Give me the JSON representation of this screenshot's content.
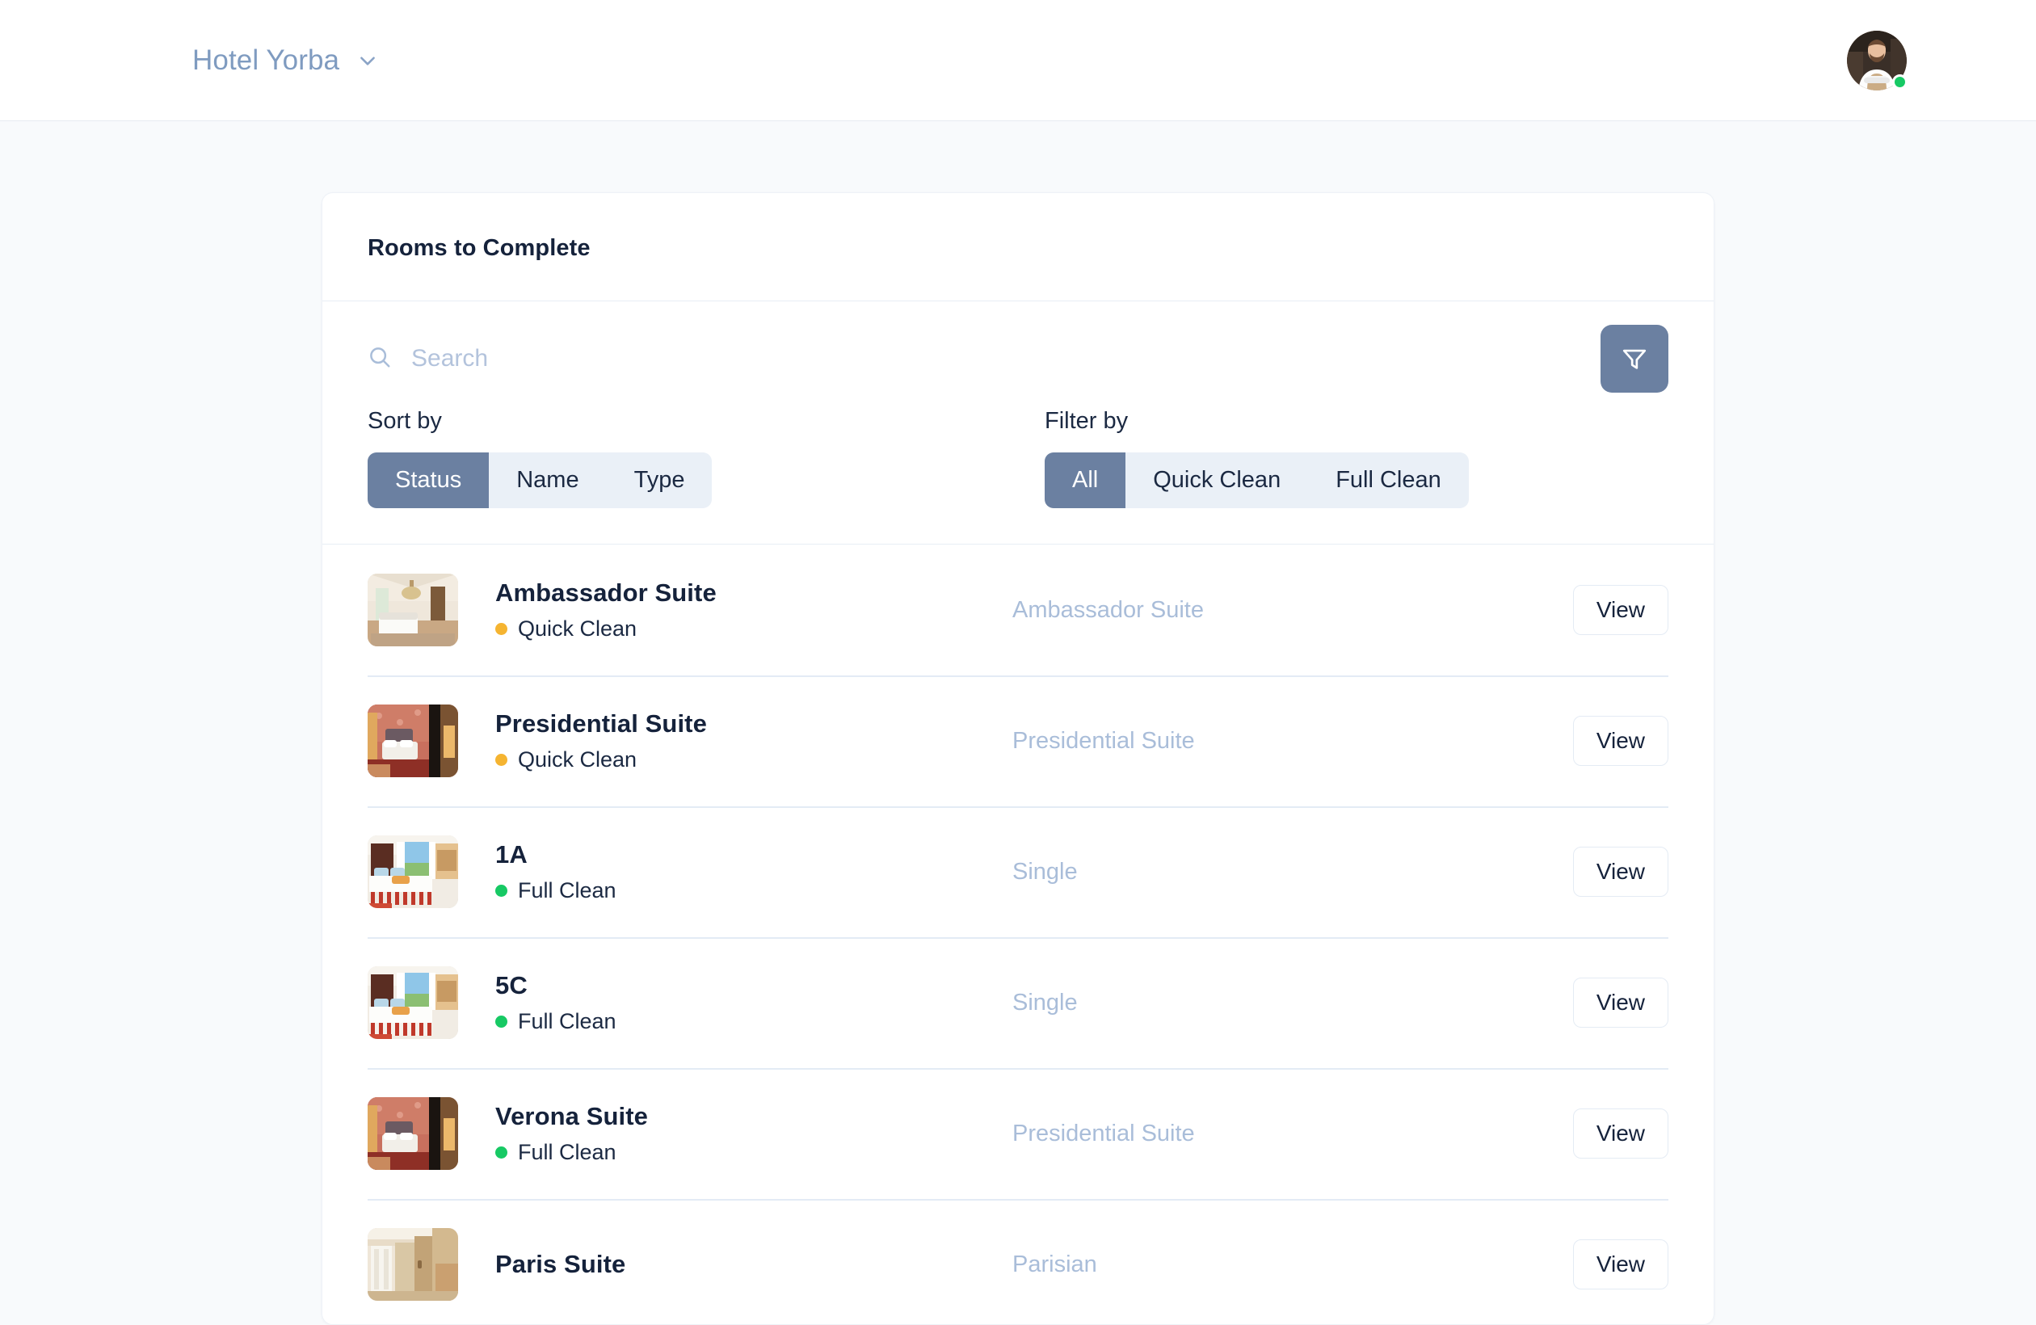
{
  "navbar": {
    "brand_label": "Hotel Yorba",
    "brand_caret_icon": "chevron-down-icon",
    "avatar_icon": "user-avatar-photo",
    "status": "online",
    "status_color": "#17c964"
  },
  "card": {
    "title": "Rooms to Complete"
  },
  "search": {
    "icon": "search-icon",
    "placeholder": "Search",
    "value": ""
  },
  "filter_button": {
    "icon": "funnel-icon",
    "color": "#6b80a1"
  },
  "sort": {
    "label": "Sort by",
    "options": [
      "Status",
      "Name",
      "Type"
    ],
    "selected": "Status"
  },
  "filter": {
    "label": "Filter by",
    "options": [
      "All",
      "Quick Clean",
      "Full Clean"
    ],
    "selected": "All"
  },
  "status_colors": {
    "quick_clean": "#f5b431",
    "full_clean": "#17c964"
  },
  "rows": [
    {
      "name": "Ambassador Suite",
      "status": "Quick Clean",
      "status_color": "#f5b431",
      "type": "Ambassador Suite",
      "action": "View",
      "thumb": "room-photo-ambassador"
    },
    {
      "name": "Presidential Suite",
      "status": "Quick Clean",
      "status_color": "#f5b431",
      "type": "Presidential Suite",
      "action": "View",
      "thumb": "room-photo-presidential"
    },
    {
      "name": "1A",
      "status": "Full Clean",
      "status_color": "#17c964",
      "type": "Single",
      "action": "View",
      "thumb": "room-photo-single"
    },
    {
      "name": "5C",
      "status": "Full Clean",
      "status_color": "#17c964",
      "type": "Single",
      "action": "View",
      "thumb": "room-photo-single"
    },
    {
      "name": "Verona Suite",
      "status": "Full Clean",
      "status_color": "#17c964",
      "type": "Presidential Suite",
      "action": "View",
      "thumb": "room-photo-verona"
    },
    {
      "name": "Paris Suite",
      "status": "",
      "status_color": "",
      "type": "Parisian",
      "action": "View",
      "thumb": "room-photo-paris"
    }
  ]
}
